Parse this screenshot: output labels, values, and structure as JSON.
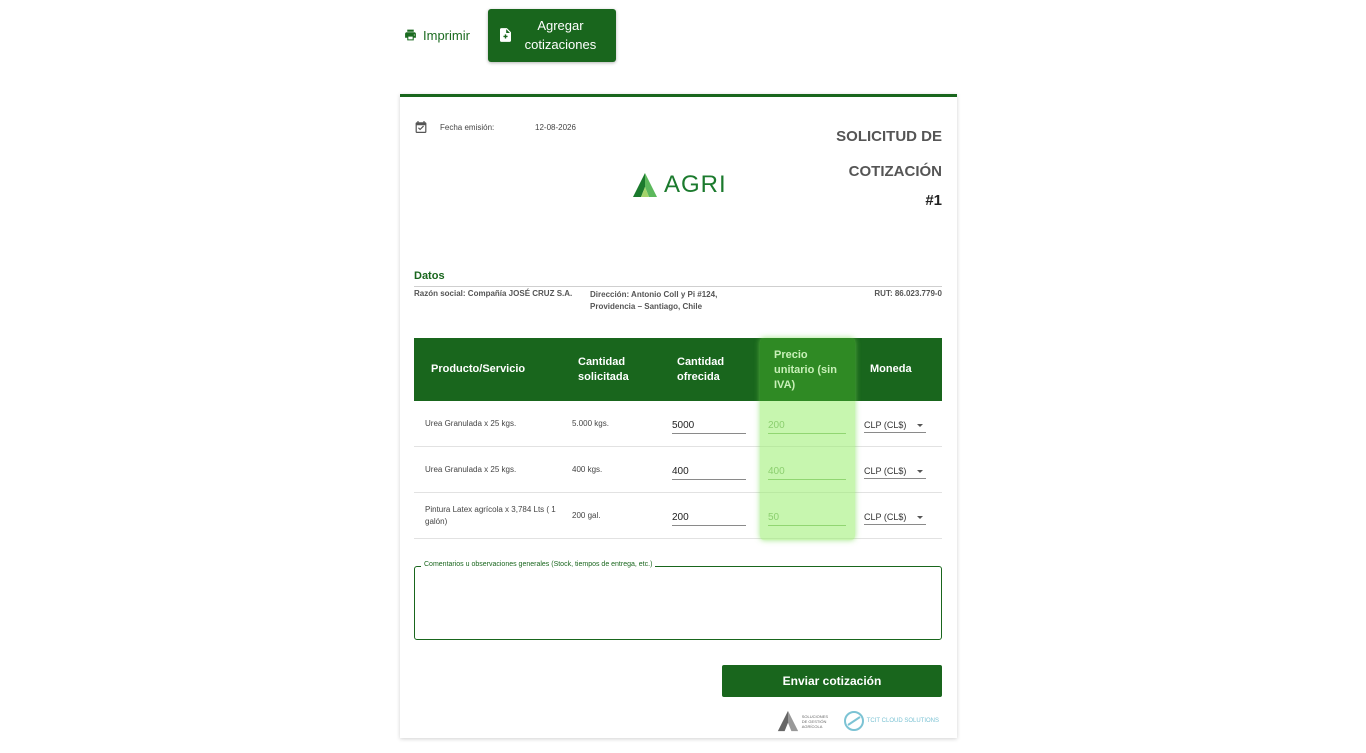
{
  "toolbar": {
    "print_label": "Imprimir",
    "add_label": "Agregar cotizaciones"
  },
  "header": {
    "date_label": "Fecha emisión:",
    "date_value": "12-08-2026",
    "title_line1": "SOLICITUD DE",
    "title_line2": "COTIZACIÓN",
    "title_number": "#1",
    "logo_text": "AGRI"
  },
  "datos": {
    "section_title": "Datos",
    "razon_social": "Razón social: Compañía JOSÉ CRUZ S.A.",
    "direccion_line1": "Dirección: Antonio Coll y Pi #124,",
    "direccion_line2": "Providencia – Santiago, Chile",
    "rut": "RUT: 86.023.779-0"
  },
  "table": {
    "headers": [
      "Producto/Servicio",
      "Cantidad solicitada",
      "Cantidad ofrecida",
      "Precio unitario (sin IVA)",
      "Moneda"
    ],
    "rows": [
      {
        "producto": "Urea Granulada x 25 kgs.",
        "solicitada": "5.000 kgs.",
        "ofrecida": "5000",
        "precio": "200",
        "moneda": "CLP (CL$)"
      },
      {
        "producto": "Urea Granulada x 25 kgs.",
        "solicitada": "400 kgs.",
        "ofrecida": "400",
        "precio": "400",
        "moneda": "CLP (CL$)"
      },
      {
        "producto": "Pintura Latex agrícola x 3,784 Lts ( 1 galón)",
        "solicitada": "200 gal.",
        "ofrecida": "200",
        "precio": "50",
        "moneda": "CLP (CL$)"
      }
    ]
  },
  "comments": {
    "label": "Comentarios u observaciones generales (Stock, tiempos de entrega, etc.)",
    "value": ""
  },
  "actions": {
    "send_label": "Enviar cotización"
  },
  "footer": {
    "logo1_text": "SOLUCIONES DE GESTIÓN AGRÍCOLA",
    "logo2_text": "TCIT CLOUD SOLUTIONS"
  },
  "colors": {
    "brand_green": "#19661d",
    "highlight": "#99ee6e"
  }
}
